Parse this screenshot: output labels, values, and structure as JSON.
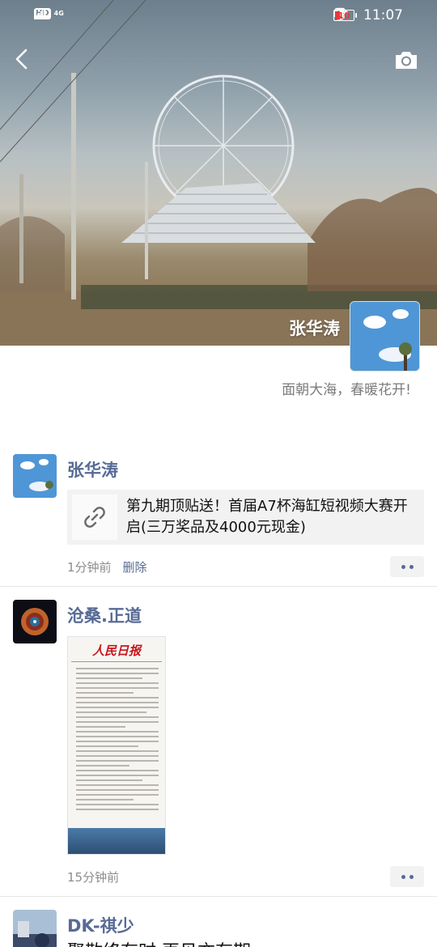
{
  "status_bar": {
    "left_badge": "HD",
    "network": "4G",
    "time": "11:07",
    "battery": "10"
  },
  "icons": {
    "back": "back-chevron-icon",
    "camera": "camera-icon",
    "link": "link-icon",
    "eye": "eye-icon",
    "alarm": "alarm-icon",
    "vibrate": "vibrate-icon",
    "battery": "battery-icon",
    "signal": "signal-icon"
  },
  "profile": {
    "name": "张华涛",
    "signature": "面朝大海，春暖花开!"
  },
  "posts": [
    {
      "author": "张华涛",
      "link_title": "第九期顶贴送！首届A7杯海缸短视频大赛开启(三万奖品及4000元现金)",
      "time": "1分钟前",
      "delete_label": "删除"
    },
    {
      "author": "沧桑.正道",
      "time": "15分钟前",
      "image_masthead": "人民日报"
    },
    {
      "author": "DK-祺少",
      "text": "聚散终有时 再见亦有期"
    }
  ],
  "colors": {
    "link_blue": "#576b95",
    "meta_gray": "#8c8c8c",
    "card_bg": "#f2f2f2",
    "battery_low": "#e23b3b"
  }
}
